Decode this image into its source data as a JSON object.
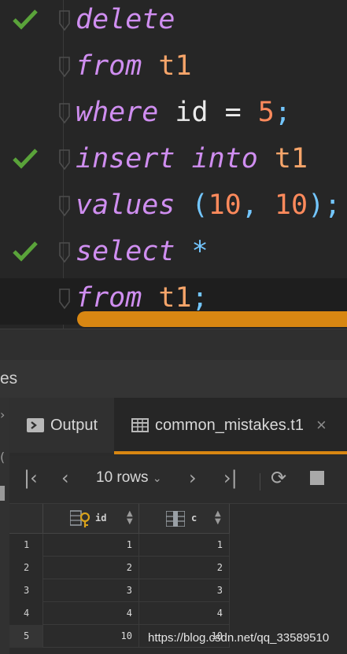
{
  "editor": {
    "lines": [
      {
        "tokens": [
          {
            "t": "delete",
            "c": "kw"
          }
        ],
        "check": true
      },
      {
        "tokens": [
          {
            "t": "from",
            "c": "kw"
          },
          {
            "t": " ",
            "c": "op"
          },
          {
            "t": "t1",
            "c": "id"
          }
        ],
        "check": false
      },
      {
        "tokens": [
          {
            "t": "where",
            "c": "kw"
          },
          {
            "t": " id = ",
            "c": "op"
          },
          {
            "t": "5",
            "c": "num"
          },
          {
            "t": ";",
            "c": "sc"
          }
        ],
        "check": false
      },
      {
        "tokens": [
          {
            "t": "insert",
            "c": "kw"
          },
          {
            "t": " ",
            "c": "op"
          },
          {
            "t": "into",
            "c": "kw"
          },
          {
            "t": " ",
            "c": "op"
          },
          {
            "t": "t1",
            "c": "id"
          }
        ],
        "check": true
      },
      {
        "tokens": [
          {
            "t": "values",
            "c": "kw"
          },
          {
            "t": " ",
            "c": "op"
          },
          {
            "t": "(",
            "c": "pn"
          },
          {
            "t": "10",
            "c": "num"
          },
          {
            "t": ", ",
            "c": "pn"
          },
          {
            "t": "10",
            "c": "num"
          },
          {
            "t": ");",
            "c": "pn"
          }
        ],
        "check": false
      },
      {
        "tokens": [
          {
            "t": "select",
            "c": "kw"
          },
          {
            "t": " ",
            "c": "op"
          },
          {
            "t": "*",
            "c": "pn"
          }
        ],
        "check": true
      },
      {
        "tokens": [
          {
            "t": "from",
            "c": "kw"
          },
          {
            "t": " ",
            "c": "op"
          },
          {
            "t": "t1",
            "c": "id"
          },
          {
            "t": ";",
            "c": "sc"
          }
        ],
        "check": false
      }
    ]
  },
  "panel": {
    "title": "es"
  },
  "tabs": {
    "output_label": "Output",
    "table_label": "common_mistakes.t1",
    "close_symbol": "×"
  },
  "toolbar": {
    "rows_label": "10 rows"
  },
  "grid": {
    "columns": [
      "id",
      "c"
    ],
    "rows": [
      {
        "n": "1",
        "id": "1",
        "c": "1"
      },
      {
        "n": "2",
        "id": "2",
        "c": "2"
      },
      {
        "n": "3",
        "id": "3",
        "c": "3"
      },
      {
        "n": "4",
        "id": "4",
        "c": "4"
      },
      {
        "n": "5",
        "id": "10",
        "c": "10"
      }
    ]
  },
  "watermark": "https://blog.csdn.net/qq_33589510",
  "colors": {
    "accent": "#d88712",
    "check": "#5aa33a",
    "keyword": "#cf8ef0",
    "identifier": "#f7a56a",
    "number": "#ff8a5c"
  }
}
